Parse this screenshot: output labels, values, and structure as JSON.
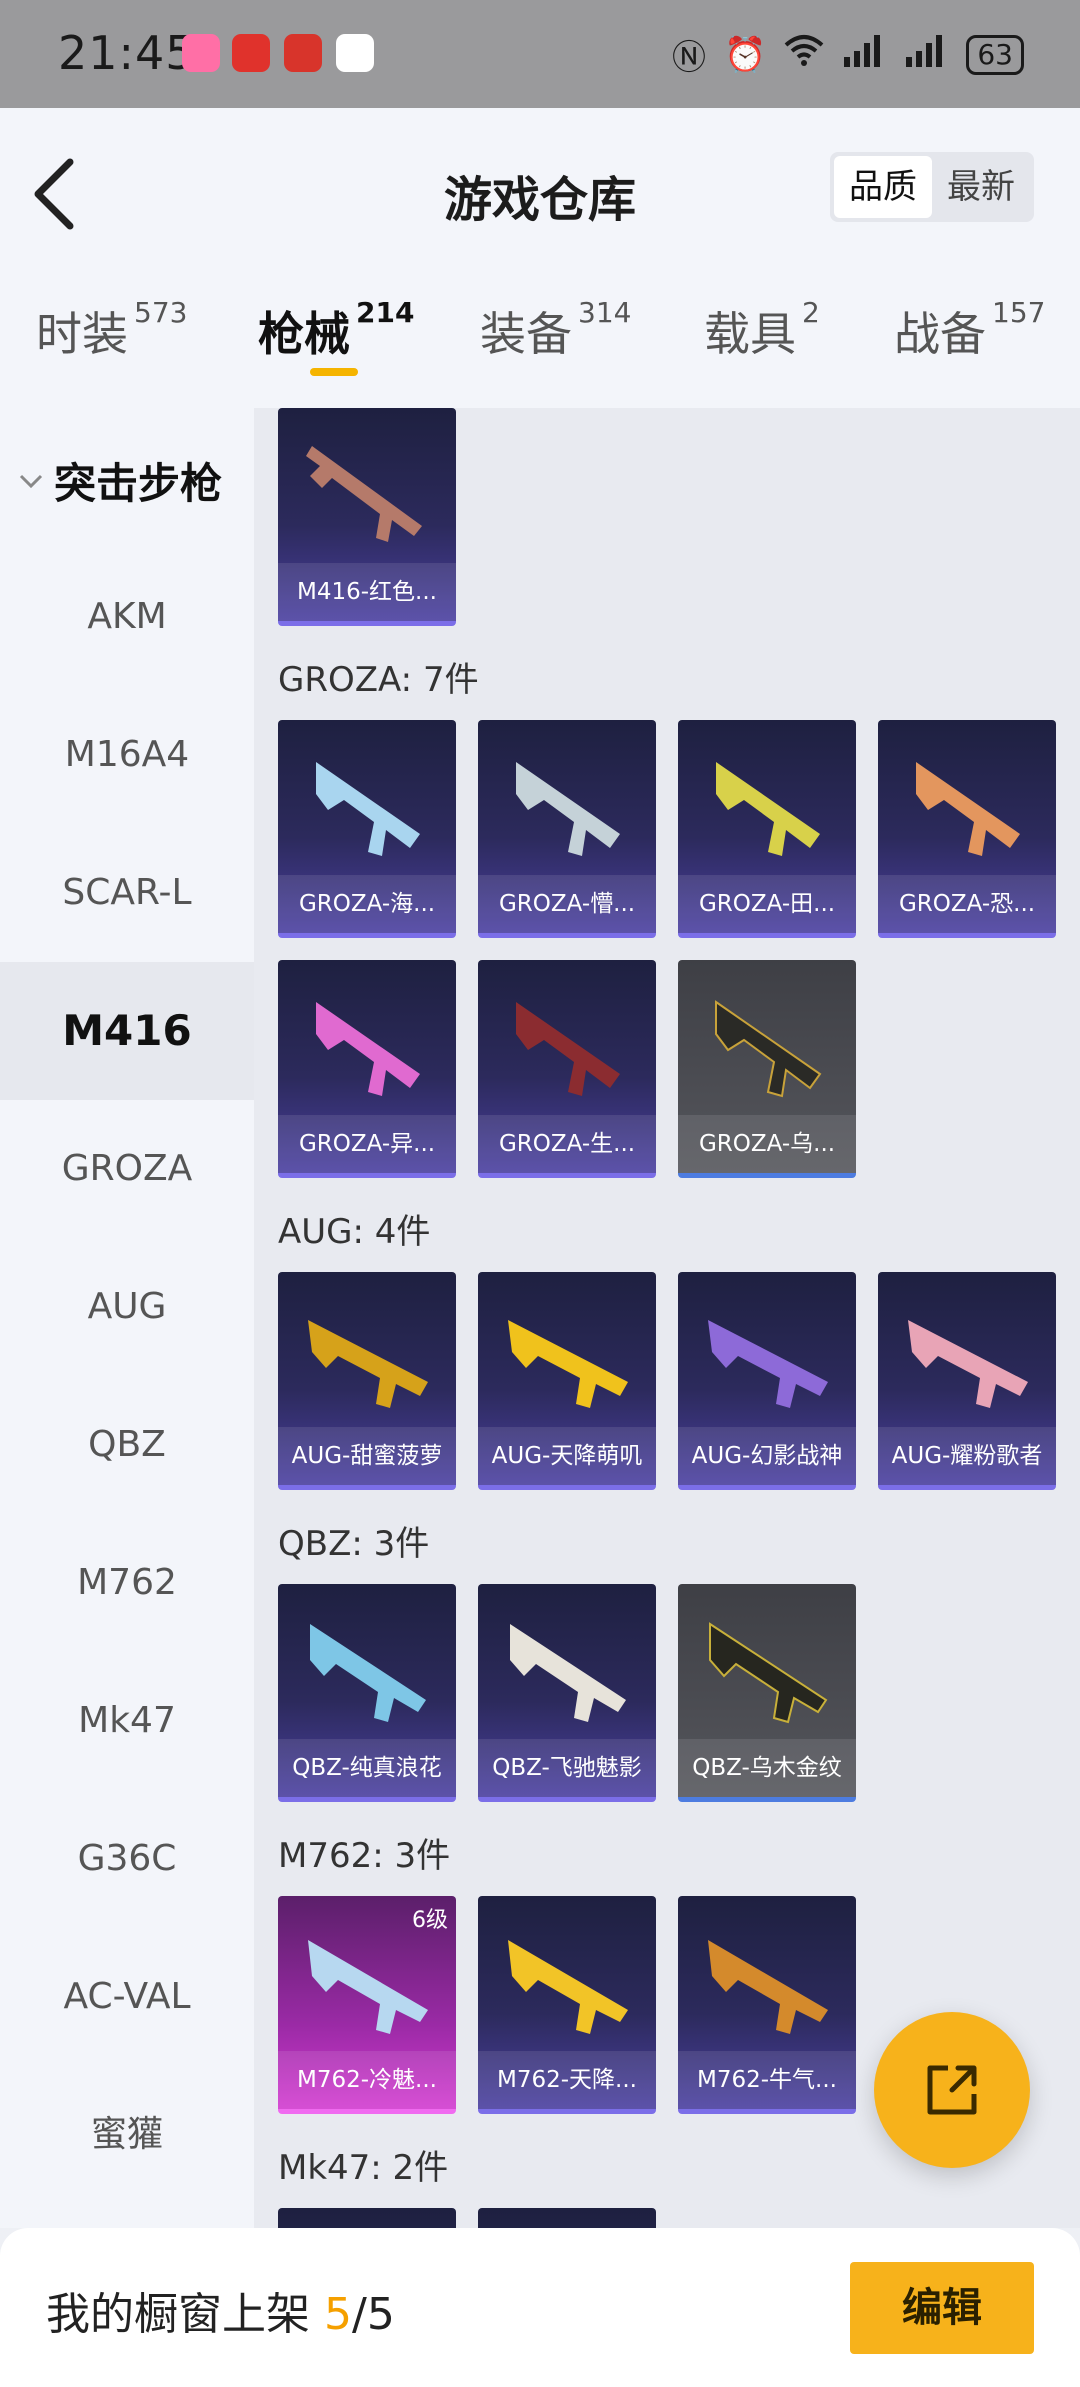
{
  "status_bar": {
    "time": "21:45",
    "battery": "63",
    "signal_label": "6"
  },
  "header": {
    "title": "游戏仓库",
    "sort_options": [
      "品质",
      "最新"
    ],
    "sort_active": "品质"
  },
  "tabs": [
    {
      "label": "时装",
      "count": "573"
    },
    {
      "label": "枪械",
      "count": "214",
      "active": true
    },
    {
      "label": "装备",
      "count": "314"
    },
    {
      "label": "载具",
      "count": "2"
    },
    {
      "label": "战备",
      "count": "157"
    }
  ],
  "sidebar": {
    "group": "突击步枪",
    "items": [
      "AKM",
      "M16A4",
      "SCAR-L",
      "M416",
      "GROZA",
      "AUG",
      "QBZ",
      "M762",
      "Mk47",
      "G36C",
      "AC-VAL",
      "蜜獾"
    ],
    "active": "M416"
  },
  "sections": {
    "m416": {
      "cards": [
        {
          "name": "M416-红色..."
        }
      ]
    },
    "groza": {
      "title": "GROZA: 7件",
      "cards": [
        {
          "name": "GROZA-海..."
        },
        {
          "name": "GROZA-懵..."
        },
        {
          "name": "GROZA-田..."
        },
        {
          "name": "GROZA-恐..."
        },
        {
          "name": "GROZA-异..."
        },
        {
          "name": "GROZA-生..."
        },
        {
          "name": "GROZA-乌..."
        }
      ]
    },
    "aug": {
      "title": "AUG: 4件",
      "cards": [
        {
          "name": "AUG-甜蜜菠萝"
        },
        {
          "name": "AUG-天降萌叽"
        },
        {
          "name": "AUG-幻影战神"
        },
        {
          "name": "AUG-耀粉歌者"
        }
      ]
    },
    "qbz": {
      "title": "QBZ: 3件",
      "cards": [
        {
          "name": "QBZ-纯真浪花"
        },
        {
          "name": "QBZ-飞驰魅影"
        },
        {
          "name": "QBZ-乌木金纹"
        }
      ]
    },
    "m762": {
      "title": "M762: 3件",
      "cards": [
        {
          "name": "M762-冷魅...",
          "level": "6级"
        },
        {
          "name": "M762-天降..."
        },
        {
          "name": "M762-牛气..."
        }
      ]
    },
    "mk47": {
      "title": "Mk47: 2件"
    }
  },
  "bottom_bar": {
    "label": "我的橱窗上架",
    "count": "5",
    "total": "/5",
    "edit_label": "编辑"
  }
}
